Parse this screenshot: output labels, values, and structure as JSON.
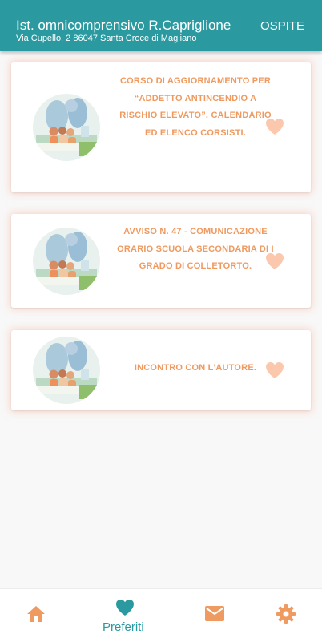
{
  "header": {
    "title": "Ist. omnicomprensivo R.Capriglione",
    "subtitle": "Via Cupello, 2 86047 Santa Croce di Magliano",
    "guest_label": "OSPITE"
  },
  "cards": [
    {
      "title": "CORSO DI AGGIORNAMENTO PER “ADDETTO ANTINCENDIO A RISCHIO ELEVATO”. CALENDARIO ED ELENCO CORSISTI.",
      "favorite_icon": "heart-icon"
    },
    {
      "title": "AVVISO N. 47 - COMUNICAZIONE ORARIO SCUOLA SECONDARIA DI I GRADO DI COLLETORTO.",
      "favorite_icon": "heart-icon"
    },
    {
      "title": "INCONTRO CON L'AUTORE.",
      "favorite_icon": "heart-icon"
    }
  ],
  "bottom_nav": {
    "items": [
      {
        "icon": "home-icon",
        "label": ""
      },
      {
        "icon": "heart-icon",
        "label": "Preferiti",
        "active": true
      },
      {
        "icon": "mail-icon",
        "label": ""
      },
      {
        "icon": "gear-icon",
        "label": ""
      }
    ]
  },
  "colors": {
    "primary": "#2a9aa0",
    "accent": "#ef9a60",
    "heart_light": "#fcc8ad",
    "background": "#f8f8f8"
  }
}
